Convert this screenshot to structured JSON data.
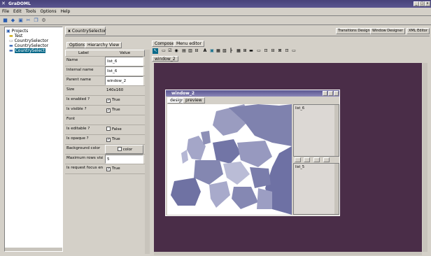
{
  "app": {
    "title": "GraDOML",
    "window_controls": [
      "_",
      "□",
      "x"
    ]
  },
  "menu": {
    "items": [
      "File",
      "Edit",
      "Tools",
      "Options",
      "Help"
    ]
  },
  "toolbar": {
    "icons": [
      "new-project-icon",
      "open-icon",
      "save-icon",
      "cut-icon",
      "copy-icon",
      "settings-icon"
    ]
  },
  "projects": {
    "root": "Projects",
    "items": [
      {
        "label": "Test",
        "selected": false
      },
      {
        "label": "CountrySelector",
        "selected": false
      },
      {
        "label": "CountrySelector",
        "selected": false
      },
      {
        "label": "CountrySelect",
        "selected": true
      }
    ]
  },
  "doc": {
    "tab_label": "CountrySelector",
    "close_glyph": "x",
    "header_buttons": [
      "Transitions Designer",
      "Window Designer",
      "XML Editor"
    ]
  },
  "props": {
    "tabs": [
      "Options",
      "Hierarchy View"
    ],
    "header": {
      "label": "Label",
      "value": "Value"
    },
    "rows": [
      {
        "label": "Name",
        "value": "list_6",
        "type": "text"
      },
      {
        "label": "Internal name",
        "value": "list_6",
        "type": "text"
      },
      {
        "label": "Parent name",
        "value": "window_2",
        "type": "text"
      },
      {
        "label": "Size",
        "value": "140x160",
        "type": "plain"
      },
      {
        "label": "Is enabled ?",
        "value": "True",
        "type": "check",
        "checked": true
      },
      {
        "label": "Is visible ?",
        "value": "True",
        "type": "check",
        "checked": true
      },
      {
        "label": "Font",
        "value": "",
        "type": "plain"
      },
      {
        "label": "Is editable ?",
        "value": "False",
        "type": "check",
        "checked": false
      },
      {
        "label": "Is opaque ?",
        "value": "True",
        "type": "check",
        "checked": true
      },
      {
        "label": "Background color",
        "value": "color",
        "type": "color"
      },
      {
        "label": "Maximum rows visi...",
        "value": "5",
        "type": "text"
      },
      {
        "label": "Is request focus en...",
        "value": "True",
        "type": "check",
        "checked": true
      }
    ]
  },
  "composer": {
    "tabs": [
      "Composer",
      "Menu editor"
    ],
    "subtab": "window_2",
    "window": {
      "title": "window_2",
      "tabs": [
        "design",
        "preview"
      ],
      "list1_label": "list_6",
      "list2_label": "list_5"
    }
  },
  "colors": {
    "titlebar": "#47427a",
    "canvas": "#4a2d48",
    "selection": "#0a6a8a"
  }
}
